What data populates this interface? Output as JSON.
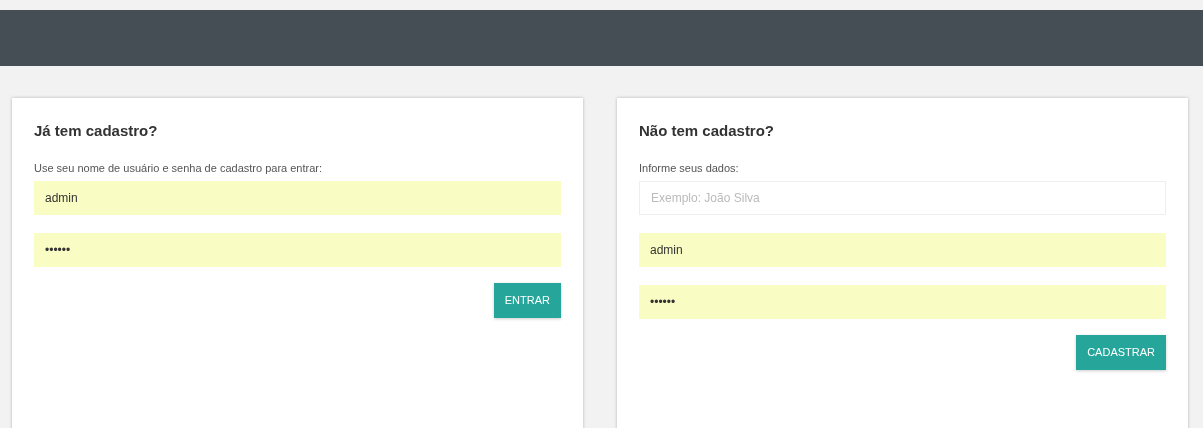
{
  "cards": [
    {
      "title": "Já tem cadastro?",
      "description": "Use seu nome de usuário e senha de cadastro para entrar:",
      "fields": [
        {
          "value": "admin",
          "autofilled": true
        },
        {
          "value": "••••••",
          "autofilled": true
        }
      ],
      "button": "ENTRAR"
    },
    {
      "title": "Não tem cadastro?",
      "description": "Informe seus dados:",
      "fields": [
        {
          "placeholder": "Exemplo: João Silva",
          "autofilled": false
        },
        {
          "value": "admin",
          "autofilled": true
        },
        {
          "value": "••••••",
          "autofilled": true
        }
      ],
      "button": "CADASTRAR"
    }
  ]
}
